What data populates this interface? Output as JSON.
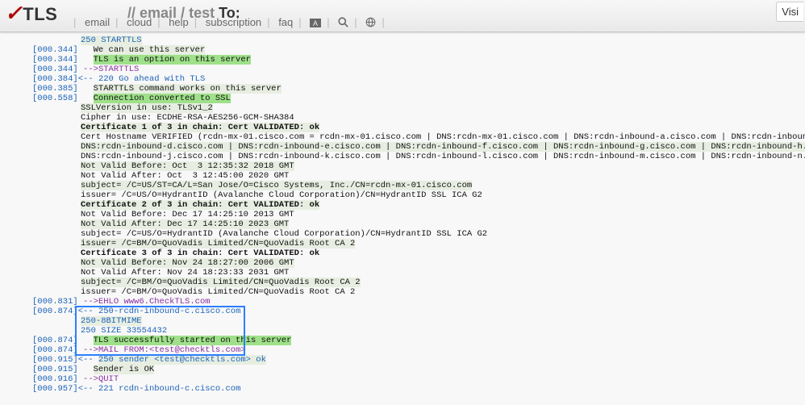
{
  "header": {
    "logo_text": "TLS",
    "crumb_prefix": "// ",
    "crumb_a": "email",
    "crumb_b": "test",
    "crumb_to": "To:",
    "visi": "Visi"
  },
  "nav": {
    "email": "email",
    "cloud": "cloud",
    "help": "help",
    "subscription": "subscription",
    "faq": "faq"
  },
  "log": {
    "l01_ts": "",
    "l01": "250 STARTTLS",
    "l02_ts": "[000.344]",
    "l02": "We can use this server",
    "l03_ts": "[000.344]",
    "l03": "TLS is an option on this server",
    "l04_ts": "[000.344]",
    "l04_arrow": " -->",
    "l04": "STARTTLS",
    "l05_ts": "[000.384]",
    "l05_arrow": "<-- ",
    "l05": "220 Go ahead with TLS",
    "l06_ts": "[000.385]",
    "l06": "STARTTLS command works on this server",
    "l07_ts": "[000.558]",
    "l07": "Connection converted to SSL",
    "l08": "SSLVersion in use: TLSv1_2",
    "l09": "Cipher in use: ECDHE-RSA-AES256-GCM-SHA384",
    "l10": "Certificate 1 of 3 in chain: Cert VALIDATED: ok",
    "l11": "Cert Hostname VERIFIED (rcdn-mx-01.cisco.com = rcdn-mx-01.cisco.com | DNS:rcdn-mx-01.cisco.com | DNS:rcdn-inbound-a.cisco.com | DNS:rcdn-inbound-b.cisco.com | DNS:rcdn-inbound-c.cisco.com |",
    "l12": "DNS:rcdn-inbound-d.cisco.com | DNS:rcdn-inbound-e.cisco.com | DNS:rcdn-inbound-f.cisco.com | DNS:rcdn-inbound-g.cisco.com | DNS:rcdn-inbound-h.cisco.com | DNS:rcdn-inbound-i.cisco.com |",
    "l13": "DNS:rcdn-inbound-j.cisco.com | DNS:rcdn-inbound-k.cisco.com | DNS:rcdn-inbound-l.cisco.com | DNS:rcdn-inbound-m.cisco.com | DNS:rcdn-inbound-n.cisco.com)",
    "l14": "Not Valid Before: Oct  3 12:35:32 2018 GMT",
    "l15": "Not Valid After: Oct  3 12:45:00 2020 GMT",
    "l16": "subject= /C=US/ST=CA/L=San Jose/O=Cisco Systems, Inc./CN=rcdn-mx-01.cisco.com",
    "l17": "issuer= /C=US/O=HydrantID (Avalanche Cloud Corporation)/CN=HydrantID SSL ICA G2",
    "l18": "Certificate 2 of 3 in chain: Cert VALIDATED: ok",
    "l19": "Not Valid Before: Dec 17 14:25:10 2013 GMT",
    "l20": "Not Valid After: Dec 17 14:25:10 2023 GMT",
    "l21": "subject= /C=US/O=HydrantID (Avalanche Cloud Corporation)/CN=HydrantID SSL ICA G2",
    "l22": "issuer= /C=BM/O=QuoVadis Limited/CN=QuoVadis Root CA 2",
    "l23": "Certificate 3 of 3 in chain: Cert VALIDATED: ok",
    "l24": "Not Valid Before: Nov 24 18:27:00 2006 GMT",
    "l25": "Not Valid After: Nov 24 18:23:33 2031 GMT",
    "l26": "subject= /C=BM/O=QuoVadis Limited/CN=QuoVadis Root CA 2",
    "l27": "issuer= /C=BM/O=QuoVadis Limited/CN=QuoVadis Root CA 2",
    "l28_ts": "[000.831]",
    "l28_arrow": " -->",
    "l28": "EHLO www6.CheckTLS.com",
    "l29_ts": "[000.874]",
    "l29_arrow": "<-- ",
    "l29": "250-rcdn-inbound-c.cisco.com",
    "l30": "250-8BITMIME",
    "l31": "250 SIZE 33554432",
    "l32_ts": "[000.874]",
    "l32": "TLS successfully started on this server",
    "l33_ts": "[000.874]",
    "l33_arrow": " -->",
    "l33": "MAIL FROM:<test@checktls.com>",
    "l34_ts": "[000.915]",
    "l34_arrow": "<-- ",
    "l34": "250 sender <test@checktls.com> ok",
    "l35_ts": "[000.915]",
    "l35": "Sender is OK",
    "l36_ts": "[000.916]",
    "l36_arrow": " -->",
    "l36": "QUIT",
    "l37_ts": "[000.957]",
    "l37_arrow": "<-- ",
    "l37": "221 rcdn-inbound-c.cisco.com"
  }
}
